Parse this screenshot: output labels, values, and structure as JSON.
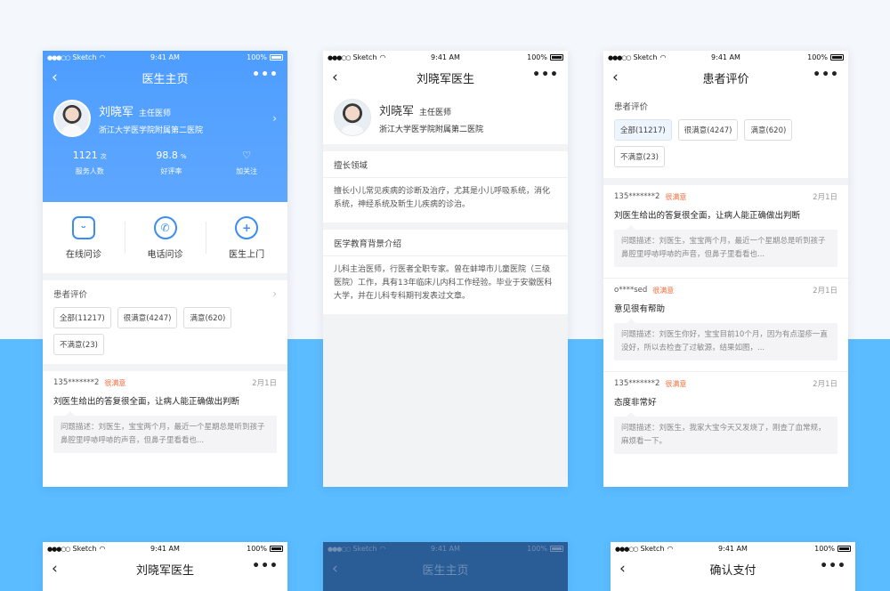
{
  "status": {
    "carrier": "Sketch",
    "time": "9:41 AM",
    "battery": "100%",
    "dots": "●●●○○"
  },
  "nav": {
    "back": "‹",
    "more": "•••"
  },
  "screen1": {
    "title": "医生主页",
    "doctor": {
      "name": "刘晓军",
      "title": "主任医师",
      "hospital": "浙江大学医学院附属第二医院"
    },
    "stats": [
      {
        "num": "1121",
        "unit": "次",
        "label": "服务人数"
      },
      {
        "num": "98.8",
        "unit": "%",
        "label": "好评率"
      },
      {
        "num": "",
        "unit": "",
        "label": "加关注"
      }
    ],
    "services": [
      {
        "label": "在线问诊",
        "icon": "chat-icon"
      },
      {
        "label": "电话问诊",
        "icon": "phone-icon"
      },
      {
        "label": "医生上门",
        "icon": "doctor-visit-icon"
      }
    ],
    "reviews_title": "患者评价",
    "tags": [
      "全部(11217)",
      "很满意(4247)",
      "满意(620)",
      "不满意(23)"
    ],
    "review": {
      "user": "135*******2",
      "badge": "很满意",
      "date": "2月1日",
      "title": "刘医生给出的答复很全面，让病人能正确做出判断",
      "desc": "问题描述：刘医生，宝宝两个月，最近一个星期总是听到孩子鼻腔里呼哧呼哧的声音，但鼻子里看看也..."
    }
  },
  "screen2": {
    "title": "刘晓军医生",
    "doctor": {
      "name": "刘晓军",
      "title": "主任医师",
      "hospital": "浙江大学医学院附属第二医院"
    },
    "specialty_title": "擅长领域",
    "specialty": "擅长小儿常见疾病的诊断及治疗，尤其是小儿呼吸系统，消化系统，神经系统及新生儿疾病的诊治。",
    "edu_title": "医学教育背景介绍",
    "edu": "儿科主治医师，行医者全职专家。曾在蚌埠市儿童医院（三级医院）工作，具有13年临床儿内科工作经验。毕业于安徽医科大学，并在儿科专科期刊发表过文章。"
  },
  "screen3": {
    "title": "患者评价",
    "filter_title": "患者评价",
    "tags": [
      "全部(11217)",
      "很满意(4247)",
      "满意(620)",
      "不满意(23)"
    ],
    "reviews": [
      {
        "user": "135*******2",
        "badge": "很满意",
        "date": "2月1日",
        "title": "刘医生给出的答复很全面，让病人能正确做出判断",
        "desc": "问题描述：刘医生，宝宝两个月，最近一个星期总是听到孩子鼻腔里呼哧呼哧的声音，但鼻子里看看也..."
      },
      {
        "user": "o****sed",
        "badge": "很满意",
        "date": "2月1日",
        "title": "意见很有帮助",
        "desc": "问题描述：刘医生你好，宝宝目前10个月，因为有点湿疹一直没好，所以去检查了过敏源，结果如图，..."
      },
      {
        "user": "135*******2",
        "badge": "很满意",
        "date": "2月1日",
        "title": "态度非常好",
        "desc": "问题描述：刘医生，我家大宝今天又发烧了，刚查了血常规，麻烦看一下。"
      }
    ]
  },
  "screen4": {
    "title": "刘晓军医生"
  },
  "screen5": {
    "title": "医生主页"
  },
  "screen6": {
    "title": "确认支付"
  },
  "colors": {
    "accent": "#4d9dff",
    "bg_bottom": "#5bbcff",
    "badge": "#f26b3a"
  }
}
